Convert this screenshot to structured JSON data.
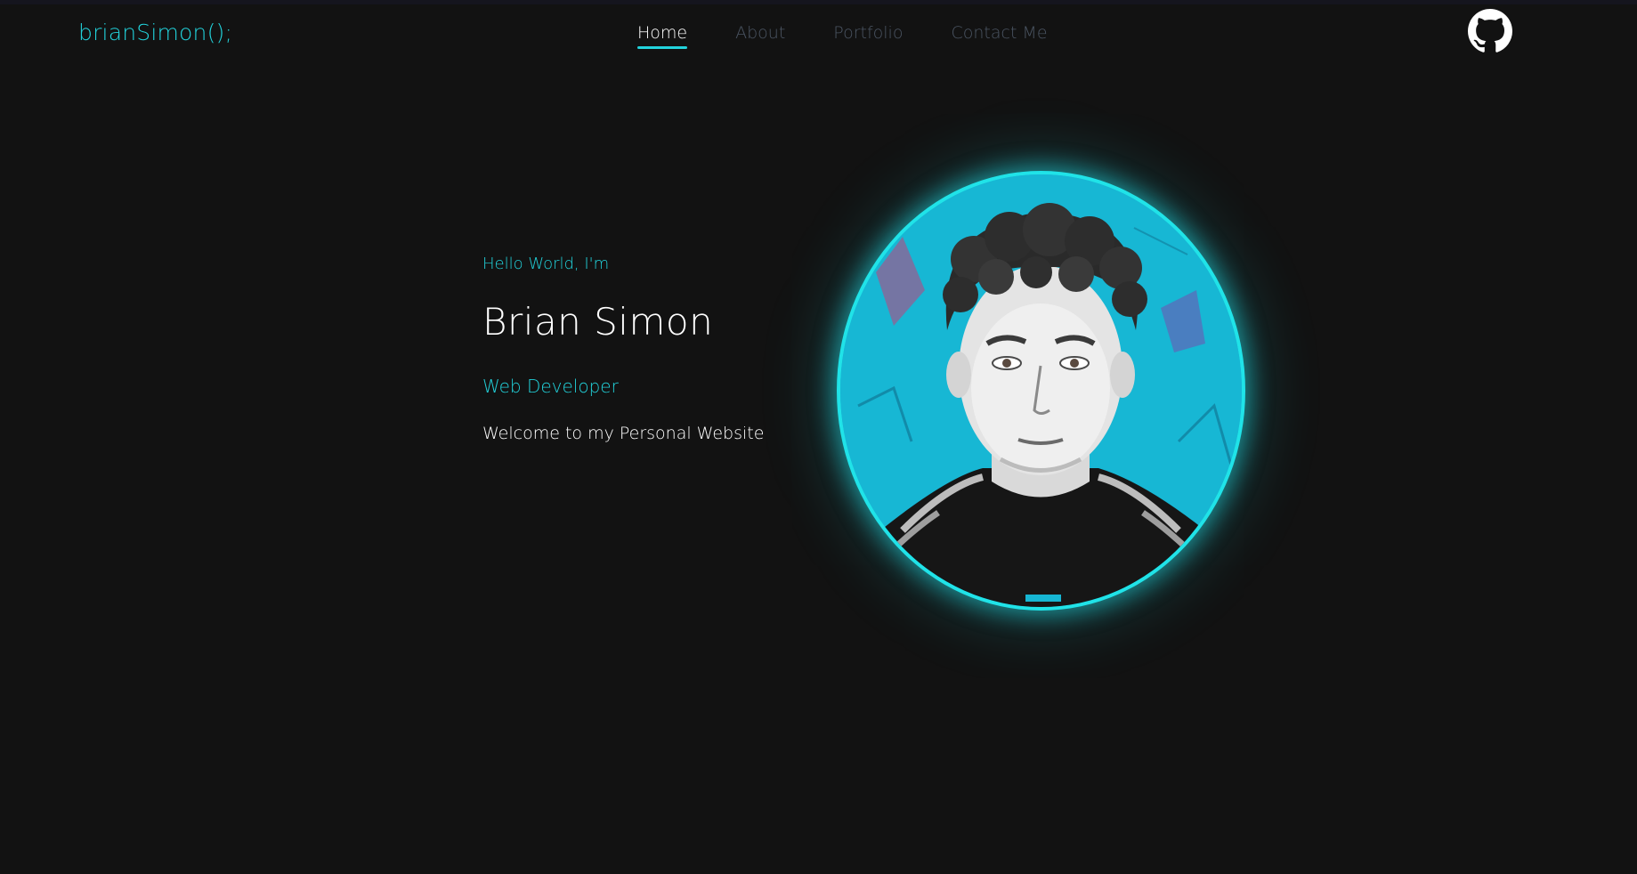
{
  "nav": {
    "logo": "brianSimon();",
    "links": [
      {
        "label": "Home",
        "active": true
      },
      {
        "label": "About",
        "active": false
      },
      {
        "label": "Portfolio",
        "active": false
      },
      {
        "label": "Contact Me",
        "active": false
      }
    ],
    "github_icon": "github-icon"
  },
  "hero": {
    "greeting": "Hello World, I'm",
    "name": "Brian Simon",
    "role": "Web Developer",
    "welcome": "Welcome to my Personal Website"
  },
  "colors": {
    "background": "#121212",
    "accent": "#22d3dc",
    "text": "#ffffff",
    "nav_inactive": "#4b5563",
    "portrait_bg": "#16b6d3"
  }
}
